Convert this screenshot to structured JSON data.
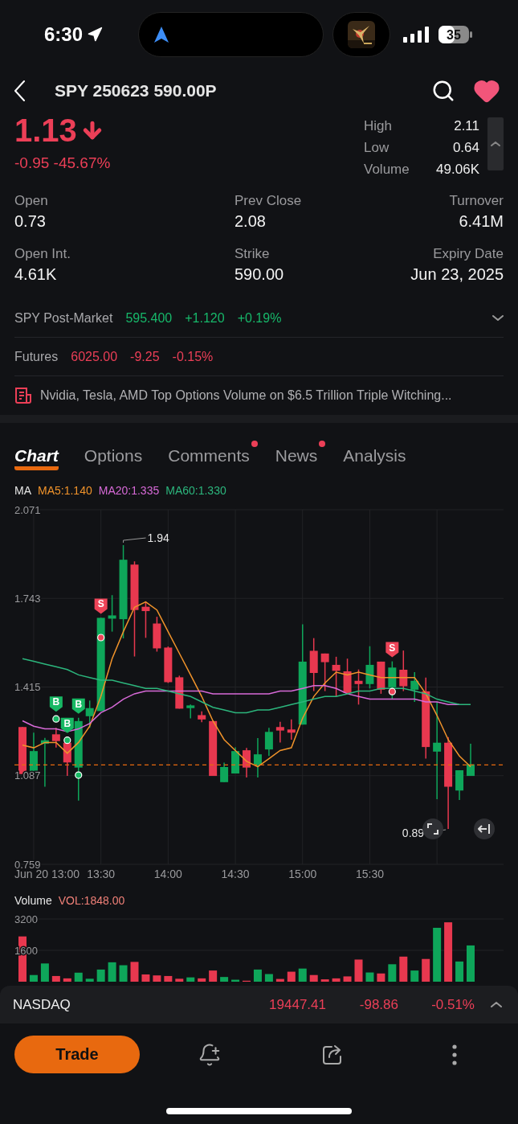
{
  "status_bar": {
    "time": "6:30",
    "battery": "35"
  },
  "header": {
    "title": "SPY 250623 590.00P",
    "favorite": true
  },
  "quote": {
    "price": "1.13",
    "falling": true,
    "change": "-0.95",
    "change_pct": "-45.67%"
  },
  "range": [
    {
      "label": "High",
      "value": "2.11"
    },
    {
      "label": "Low",
      "value": "0.64"
    },
    {
      "label": "Volume",
      "value": "49.06K"
    }
  ],
  "stats": [
    {
      "label": "Open",
      "value": "0.73"
    },
    {
      "label": "Prev Close",
      "value": "2.08"
    },
    {
      "label": "Turnover",
      "value": "6.41M"
    },
    {
      "label": "Open Int.",
      "value": "4.61K"
    },
    {
      "label": "Strike",
      "value": "590.00"
    },
    {
      "label": "Expiry Date",
      "value": "Jun 23, 2025"
    }
  ],
  "markets": [
    {
      "name": "SPY Post-Market",
      "values": [
        "595.400",
        "+1.120",
        "+0.19%"
      ],
      "falling": false,
      "expandable": true
    },
    {
      "name": "Futures",
      "values": [
        "6025.00",
        "-9.25",
        "-0.15%"
      ],
      "falling": true,
      "expandable": false
    }
  ],
  "news": {
    "headline": "Nvidia, Tesla, AMD Top Options Volume on $6.5 Trillion Triple Witching..."
  },
  "tabs": [
    {
      "label": "Chart",
      "selected": true,
      "unread": false
    },
    {
      "label": "Options",
      "selected": false,
      "unread": false
    },
    {
      "label": "Comments",
      "selected": false,
      "unread": true
    },
    {
      "label": "News",
      "selected": false,
      "unread": true
    },
    {
      "label": "Analysis",
      "selected": false,
      "unread": false
    }
  ],
  "indicators": {
    "name": "MA"
  },
  "price_chart": {
    "start_label": "Jun 20 13:00",
    "chart_data": {
      "type": "candlestick",
      "grid": true,
      "ylim": [
        0.759,
        2.071
      ],
      "categories": [
        null,
        null,
        null,
        null,
        null,
        null,
        null,
        "13:30",
        null,
        null,
        null,
        null,
        null,
        "14:00",
        null,
        null,
        null,
        null,
        null,
        "14:30",
        null,
        null,
        null,
        null,
        null,
        "15:00",
        null,
        null,
        null,
        null,
        null,
        "15:30",
        null,
        null,
        null,
        null,
        null,
        null,
        null,
        null,
        null
      ],
      "yticks": [
        {
          "value": 2.071,
          "label": "2.071"
        },
        {
          "value": 1.743,
          "label": "1.743"
        },
        {
          "value": 1.415,
          "label": "1.415"
        },
        {
          "value": 1.087,
          "label": "1.087"
        },
        {
          "value": 0.759,
          "label": "0.759"
        }
      ],
      "ohlc": [
        [
          1.267,
          1.267,
          1.093,
          1.093
        ],
        [
          1.093,
          1.246,
          1.093,
          1.178
        ],
        [
          1.205,
          1.227,
          1.046,
          1.218
        ],
        [
          1.24,
          1.264,
          1.191,
          1.215
        ],
        [
          1.209,
          1.215,
          1.086,
          1.136
        ],
        [
          1.117,
          1.301,
          0.995,
          1.289
        ],
        [
          1.307,
          1.365,
          1.264,
          1.337
        ],
        [
          1.326,
          1.671,
          1.326,
          1.671
        ],
        [
          1.668,
          1.755,
          1.62,
          1.68
        ],
        [
          1.666,
          1.94,
          1.595,
          1.886
        ],
        [
          1.868,
          1.88,
          1.528,
          1.7
        ],
        [
          1.712,
          1.73,
          1.597,
          1.696
        ],
        [
          1.65,
          1.675,
          1.546,
          1.558
        ],
        [
          1.561,
          1.565,
          1.43,
          1.433
        ],
        [
          1.451,
          1.457,
          1.335,
          1.335
        ],
        [
          1.337,
          1.35,
          1.299,
          1.347
        ],
        [
          1.311,
          1.325,
          1.285,
          1.295
        ],
        [
          1.289,
          1.289,
          1.086,
          1.086
        ],
        [
          1.063,
          1.135,
          1.063,
          1.119
        ],
        [
          1.095,
          1.192,
          1.095,
          1.178
        ],
        [
          1.181,
          1.19,
          1.08,
          1.117
        ],
        [
          1.126,
          1.226,
          1.08,
          1.166
        ],
        [
          1.184,
          1.264,
          1.16,
          1.249
        ],
        [
          1.267,
          1.286,
          1.21,
          1.254
        ],
        [
          1.258,
          1.295,
          1.22,
          1.246
        ],
        [
          1.276,
          1.647,
          1.276,
          1.509
        ],
        [
          1.549,
          1.596,
          1.4,
          1.467
        ],
        [
          1.539,
          1.539,
          1.4,
          1.507
        ],
        [
          1.497,
          1.527,
          1.38,
          1.475
        ],
        [
          1.473,
          1.52,
          1.39,
          1.393
        ],
        [
          1.438,
          1.48,
          1.35,
          1.426
        ],
        [
          1.426,
          1.566,
          1.41,
          1.497
        ],
        [
          1.509,
          1.509,
          1.39,
          1.405
        ],
        [
          1.414,
          1.51,
          1.37,
          1.487
        ],
        [
          1.479,
          1.55,
          1.4,
          1.418
        ],
        [
          1.405,
          1.47,
          1.36,
          1.438
        ],
        [
          1.399,
          1.45,
          1.15,
          1.193
        ],
        [
          1.176,
          1.36,
          1.0,
          1.209
        ],
        [
          1.209,
          1.23,
          0.89,
          1.046
        ],
        [
          1.032,
          1.107,
          0.997,
          1.107
        ],
        [
          1.086,
          1.205,
          1.086,
          1.129
        ]
      ],
      "series": [
        {
          "name": "MA5:1.140",
          "type": "line",
          "color": "#f0932b",
          "values": [
            1.2,
            1.19,
            1.21,
            1.21,
            1.17,
            1.21,
            1.27,
            1.38,
            1.52,
            1.62,
            1.71,
            1.73,
            1.7,
            1.62,
            1.54,
            1.46,
            1.38,
            1.29,
            1.22,
            1.18,
            1.14,
            1.12,
            1.15,
            1.18,
            1.19,
            1.3,
            1.38,
            1.43,
            1.47,
            1.46,
            1.47,
            1.46,
            1.45,
            1.45,
            1.45,
            1.45,
            1.39,
            1.31,
            1.22,
            1.16,
            1.12
          ]
        },
        {
          "name": "MA20:1.335",
          "type": "line",
          "color": "#d86ad8",
          "values": [
            1.29,
            1.27,
            1.26,
            1.26,
            1.25,
            1.26,
            1.28,
            1.32,
            1.34,
            1.37,
            1.39,
            1.4,
            1.4,
            1.4,
            1.4,
            1.4,
            1.4,
            1.39,
            1.39,
            1.39,
            1.39,
            1.39,
            1.39,
            1.4,
            1.4,
            1.41,
            1.42,
            1.42,
            1.41,
            1.39,
            1.38,
            1.37,
            1.37,
            1.37,
            1.37,
            1.37,
            1.36,
            1.36,
            1.35,
            1.35,
            null
          ]
        },
        {
          "name": "MA60:1.330",
          "type": "line",
          "color": "#2cb67d",
          "values": [
            1.52,
            1.51,
            1.5,
            1.49,
            1.48,
            1.46,
            1.45,
            1.44,
            1.44,
            1.43,
            1.42,
            1.41,
            1.41,
            1.4,
            1.39,
            1.38,
            1.36,
            1.34,
            1.33,
            1.32,
            1.32,
            1.33,
            1.33,
            1.34,
            1.35,
            1.36,
            1.37,
            1.38,
            1.38,
            1.39,
            1.4,
            1.4,
            1.41,
            1.41,
            1.41,
            1.4,
            1.39,
            1.37,
            1.36,
            1.35,
            1.35
          ]
        },
        {
          "name": "B",
          "type": "scatter",
          "color": "#18b864",
          "values": [
            null,
            null,
            null,
            1.297,
            1.218,
            1.089,
            null,
            null,
            null,
            null,
            null,
            null,
            null,
            null,
            null,
            null,
            null,
            null,
            null,
            null,
            null,
            null,
            null,
            null,
            null,
            null,
            null,
            null,
            null,
            null,
            null,
            null,
            null,
            null,
            null,
            null,
            null,
            null,
            null,
            null,
            null
          ]
        },
        {
          "name": "S",
          "type": "scatter",
          "color": "#ee4458",
          "values": [
            null,
            null,
            null,
            null,
            null,
            null,
            null,
            1.598,
            null,
            null,
            null,
            null,
            null,
            null,
            null,
            null,
            null,
            null,
            null,
            null,
            null,
            null,
            null,
            null,
            null,
            null,
            null,
            null,
            null,
            null,
            null,
            null,
            null,
            1.398,
            null,
            null,
            null,
            null,
            null,
            null,
            null
          ]
        }
      ],
      "ref_lines": [
        {
          "value": 1.127,
          "axis": "y"
        }
      ],
      "annotations": [
        "1.94",
        "0.89"
      ]
    }
  },
  "volume": {
    "label": "Volume",
    "chart_data": {
      "type": "bar",
      "grid": true,
      "ylim": [
        0,
        3200
      ],
      "categories": [
        null,
        null,
        null,
        null,
        null,
        null,
        null,
        null,
        null,
        null,
        null,
        null,
        null,
        null,
        null,
        null,
        null,
        null,
        null,
        null,
        null,
        null,
        null,
        null,
        null,
        null,
        null,
        null,
        null,
        null,
        null,
        null,
        null,
        null,
        null,
        null,
        null,
        null,
        null,
        null,
        null
      ],
      "yticks": [
        {
          "value": 3200,
          "label": "3200"
        },
        {
          "value": 1600,
          "label": "1600"
        }
      ],
      "series": [
        {
          "name": "VOL:1848.00",
          "color": "#e8384f",
          "values": [
            2310,
            null,
            null,
            290,
            170,
            null,
            null,
            null,
            null,
            null,
            1010,
            370,
            320,
            290,
            150,
            null,
            170,
            570,
            null,
            null,
            50,
            null,
            null,
            140,
            510,
            null,
            340,
            120,
            170,
            270,
            1130,
            null,
            420,
            null,
            1280,
            null,
            1160,
            null,
            3030,
            null,
            null
          ]
        },
        {
          "color": "#0ea65a",
          "values": [
            null,
            340,
            930,
            null,
            null,
            460,
            150,
            620,
            990,
            840,
            null,
            null,
            null,
            null,
            null,
            220,
            null,
            null,
            240,
            100,
            null,
            620,
            390,
            null,
            null,
            670,
            null,
            null,
            null,
            null,
            null,
            470,
            null,
            890,
            null,
            570,
            null,
            2750,
            null,
            1030,
            1850
          ]
        }
      ]
    }
  },
  "ticker": {
    "name": "NASDAQ",
    "values": [
      "19447.41",
      "-98.86",
      "-0.51%"
    ],
    "falling": true
  },
  "actions": {
    "trade": "Trade"
  }
}
